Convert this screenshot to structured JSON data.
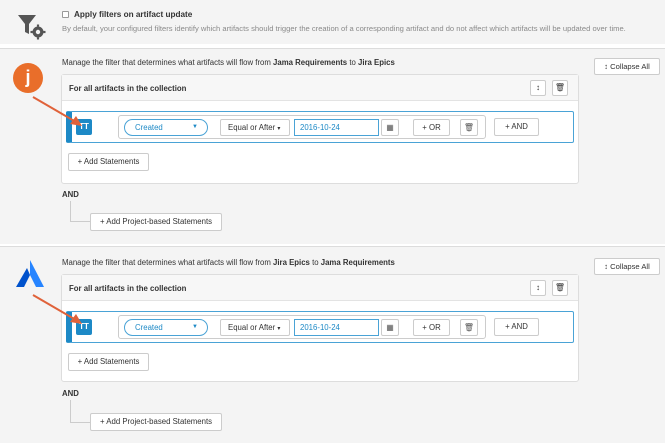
{
  "apply_filters": {
    "label": "Apply filters on artifact update",
    "description": "By default, your configured filters identify which artifacts should trigger the creation of a corresponding artifact and do not affect which artifacts will be updated over time."
  },
  "sections": [
    {
      "logo": "j",
      "title_prefix": "Manage the filter that determines what artifacts will flow from",
      "source": "Jama Requirements",
      "title_mid": "to",
      "target": "Jira Epics",
      "collapse_label": "Collapse All",
      "panel_title": "For all artifacts in the collection",
      "tag": "TT",
      "field": "Created",
      "operator": "Equal or After",
      "date": "2016-10-24",
      "or_label": "OR",
      "and_label": "AND",
      "add_statements": "Add Statements",
      "and_joiner": "AND",
      "add_project_statements": "Add Project-based Statements"
    },
    {
      "logo": "jira",
      "title_prefix": "Manage the filter that determines what artifacts will flow from",
      "source": "Jira Epics",
      "title_mid": "to",
      "target": "Jama Requirements",
      "collapse_label": "Collapse All",
      "panel_title": "For all artifacts in the collection",
      "tag": "TT",
      "field": "Created",
      "operator": "Equal or After",
      "date": "2016-10-24",
      "or_label": "OR",
      "and_label": "AND",
      "add_statements": "Add Statements",
      "and_joiner": "AND",
      "add_project_statements": "Add Project-based Statements"
    }
  ],
  "colors": {
    "accent": "#1d89c6",
    "jama_orange": "#e96e2a",
    "jira_blue": "#2684ff",
    "arrow": "#e0623a"
  },
  "icons": {
    "filter": "filter-gear-icon",
    "sort": "sort-arrows-icon",
    "trash": "trash-icon",
    "calendar": "calendar-icon",
    "caret": "caret-down-icon",
    "plus": "plus-icon"
  }
}
